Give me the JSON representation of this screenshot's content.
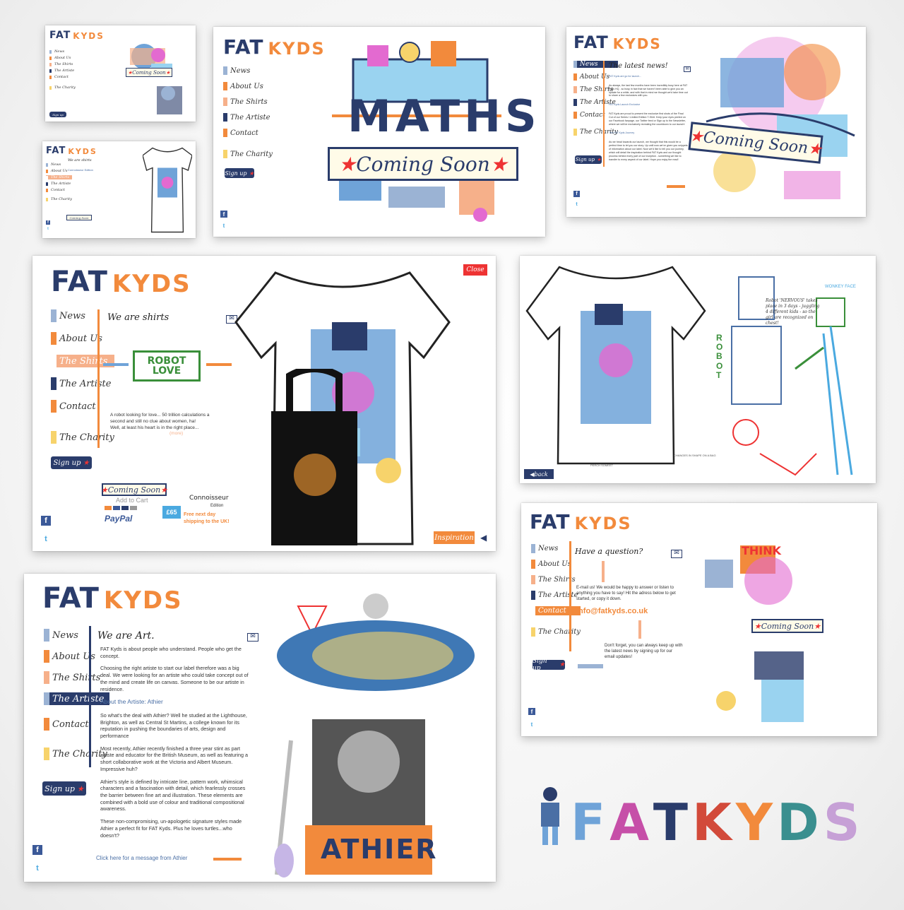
{
  "brand": {
    "fat": "FAT",
    "kyds": "KYDS",
    "wordmark": "FATKYDS"
  },
  "nav": {
    "news": "News",
    "about": "About Us",
    "shirts": "The Shirts",
    "artiste": "The Artiste",
    "contact": "Contact",
    "charity": "The Charity"
  },
  "nav_short": {
    "news": "News",
    "about": "About Us",
    "shirts": "The Shirts",
    "artiste": "The Artiste",
    "contact": "Contact",
    "charity": "The Charity"
  },
  "common": {
    "signup": "Sign up",
    "coming_soon": "Coming Soon",
    "facebook": "f",
    "twitter": "t",
    "close": "Close",
    "back": "back",
    "inspiration": "Inspiration"
  },
  "home": {
    "art_title": "MATHS"
  },
  "news_panel": {
    "title": "The latest news!",
    "subtitle": "FAT Kyds are go for launch...",
    "para1": "As always, the last few months have been incredibly busy here at FAT Kyds HQ - so busy in fact that we haven't been able to give you an update for a while; and with that in mind we thought we'd take time out to share a few exclusives with you.",
    "sub2": "FAT Kyds Launch Exclusive",
    "para2": "FAT Kyds are proud to present the exclusive first shots of the Final Cut of our Series I Limited Edition T-Shirt. Keep your eyes peeled on our Facebook fanpage, our Twitter feed or Sign up to the Newsletter, where we will be exclusively revealing the countdown to our launch!",
    "sub3": "The FAT Kyds Journey",
    "para3": "As we head towards our launch, we thought that this would be a perfect time to let you our story. Up until now we've given you snippets of information about our label. Now we'd like to tell you our journey, which will detail the inspiration behind FAT Kyds and our thought process behind every part of our inception - something we like to transfer to every aspect of our label. Hope you enjoy the read!"
  },
  "shirt_small": {
    "title": "We are shirts",
    "sub": "Connoisseur Edition"
  },
  "shirts_panel": {
    "title": "We are shirts",
    "art_label": "ROBOT LOVE",
    "desc1": "A robot looking for love... 50 trillion calculations a",
    "desc2": "second and still no clue about women, ha!",
    "desc3": "Well, at least his heart is in the right place...",
    "more": "(more)",
    "add_to_cart": "Add to Cart",
    "paypal": "PayPal",
    "price": "£65",
    "edition_title": "Connoisseur",
    "edition_sub": "Edition",
    "shipping1": "Free next day",
    "shipping2": "shipping to the UK!"
  },
  "sketch_panel": {
    "note1": "Robot 'NERVOUS' takes place in 3 days - juggling 4 different kids - so the girl are recognized on chest!",
    "note2": "WONKEY FACE",
    "note3": "ROBOT",
    "note4": "PERCH SOMEET",
    "note5": "CHANGES IN SHAPE ON A BAG"
  },
  "contact_panel": {
    "title": "Have a question?",
    "text1": "E-mail us! We would be happy to answer or listen to anything you have to say! Hit the adress below to get started, or copy it down.",
    "email": "info@fatkyds.co.uk",
    "text2": "Don't forget, you can always keep up with the latest news by signing up for our email updates!",
    "art_word": "THINK"
  },
  "art_panel": {
    "title": "We are Art.",
    "p1": "FAT Kyds is about people who understand. People who get the concept.",
    "p2": "Choosing the right artiste to start our label therefore was a big deal. We were looking for an artiste who could take concept out of the mind and create life on canvas. Someone to be our artiste in residence.",
    "sub": "About the Artiste: Athier",
    "p3": "So what's the deal with Athier? Well he studied at the Lighthouse, Brighton, as well as Central St Martins, a college known for its reputation in pushing the boundaries of arts, design and performance",
    "p4": "Most recently, Athier recently finished a three year stint as part artiste and educator for the British Museum, as well as featuring a short collaborative work at the Victoria and Albert Museum. Impressive huh?",
    "p5": "Athier's style is defined by intricate line, pattern work, whimsical characters and a fascination with detail, which fearlessly crosses the barrier between fine art and illustration. These elements are combined with a bold use of colour and traditional compositional awareness.",
    "p6": "These non-compromising, un-apologetic signature styles made Athier a perfect fit for FAT Kyds. Plus he loves turtles...who doesn't?",
    "link": "Click here for a message from Athier",
    "name_art": "ATHIER"
  },
  "colors": {
    "navy": "#2a3c6b",
    "orange": "#f28a3c",
    "peach": "#f6b08a",
    "red": "#e33",
    "fb": "#3b5998",
    "tw": "#4aa9e0"
  }
}
